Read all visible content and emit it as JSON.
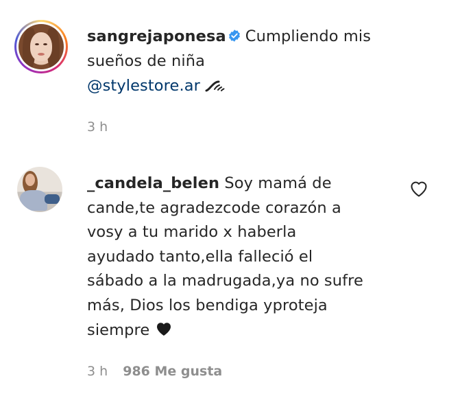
{
  "caption": {
    "username": "sangrejaponesa",
    "text": "Cumpliendo mis sueños de niña",
    "mention": "@stylestore.ar",
    "time": "3 h",
    "icons": [
      "verified-badge-icon",
      "wave-emoji-icon"
    ]
  },
  "comment": {
    "username": "_candela_belen",
    "lines": [
      "Soy mamá de",
      "cande,te agradezcode corazón a",
      "vosy a tu marido x haberla",
      "ayudado tanto,ella falleció el",
      "sábado a la madrugada,ya no sufre",
      "más, Dios los bendiga yproteja",
      "siempre"
    ],
    "time": "3 h",
    "likes": "986 Me gusta",
    "icons": [
      "black-heart-emoji-icon",
      "like-heart-icon"
    ]
  },
  "colors": {
    "text": "#262626",
    "secondary": "#8e8e8e",
    "mention": "#00376b",
    "verified": "#3897f0"
  }
}
